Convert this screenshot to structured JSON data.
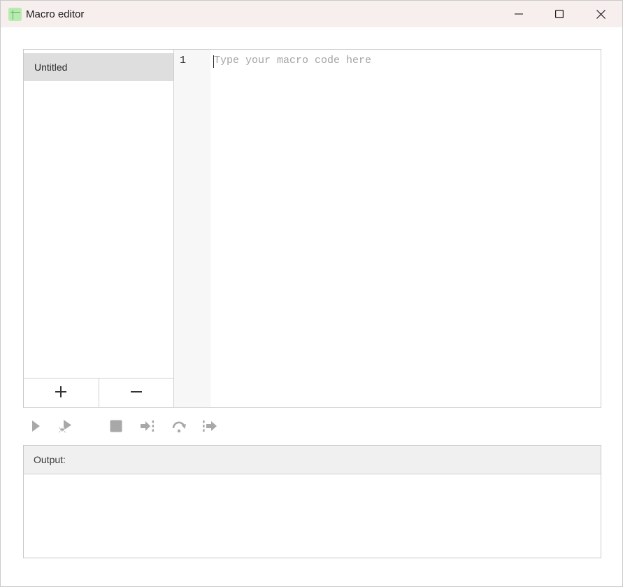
{
  "window": {
    "title": "Macro editor",
    "app_icon": "spreadsheet-icon"
  },
  "title_controls": {
    "minimize": "minimize-icon",
    "maximize": "maximize-icon",
    "close": "close-icon"
  },
  "macro_list": {
    "items": [
      {
        "label": "Untitled",
        "selected": true
      }
    ],
    "add_label": "+",
    "remove_label": "−"
  },
  "editor": {
    "line_numbers": [
      "1"
    ],
    "placeholder": "Type your macro code here",
    "value": ""
  },
  "toolbar": {
    "buttons": [
      {
        "name": "run",
        "icon": "play-icon",
        "enabled": false
      },
      {
        "name": "debug",
        "icon": "debug-run-icon",
        "enabled": false
      },
      {
        "name": "stop",
        "icon": "stop-icon",
        "enabled": false
      },
      {
        "name": "step-into",
        "icon": "step-into-icon",
        "enabled": false
      },
      {
        "name": "step-over",
        "icon": "step-over-icon",
        "enabled": false
      },
      {
        "name": "step-out",
        "icon": "step-out-icon",
        "enabled": false
      }
    ]
  },
  "output": {
    "label": "Output:",
    "content": ""
  },
  "colors": {
    "titlebar_bg": "#f7eeee",
    "selected_item_bg": "#dedede",
    "disabled_icon": "#a8a8a8",
    "app_icon_bg": "#b7ecb0"
  }
}
